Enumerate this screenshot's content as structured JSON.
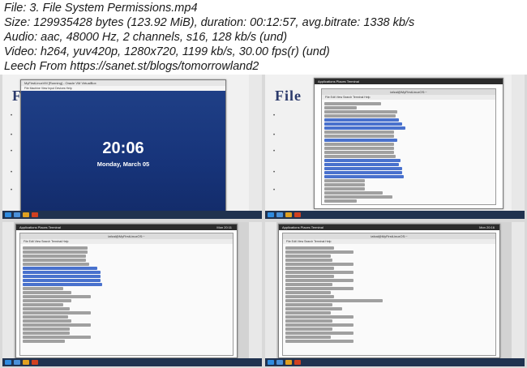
{
  "header": {
    "file": "File: 3. File System Permissions.mp4",
    "size": "Size: 129935428 bytes (123.92 MiB), duration: 00:12:57, avg.bitrate: 1338 kb/s",
    "audio": "Audio: aac, 48000 Hz, 2 channels, s16, 128 kb/s (und)",
    "video": "Video: h264, yuv420p, 1280x720, 1199 kb/s, 30.00 fps(r) (und)",
    "leech": "Leech From https://sanet.st/blogs/tomorrowland2"
  },
  "thumb1": {
    "slide_title": "File",
    "vm_title": "MyFirstLinuxVM [Running] - Oracle VM VirtualBox",
    "vm_menu": "File  Machine  View  Input  Devices  Help",
    "lock_time": "20:06",
    "lock_date": "Monday, March 05"
  },
  "thumb2": {
    "slide_title": "File",
    "term_title": "iafzal@MyFirstLinuxOS:~",
    "term_menu": "File  Edit  View  Search  Terminal  Help",
    "gnome_apps": "Applications  Places  Terminal"
  },
  "thumb3": {
    "term_title": "iafzal@MyFirstLinuxOS:~",
    "term_menu": "File  Edit  View  Search  Terminal  Help",
    "gnome_apps": "Applications  Places  Terminal",
    "gnome_time": "Mon 20:11"
  },
  "thumb4": {
    "term_title": "iafzal@MyFirstLinuxOS:~",
    "term_menu": "File  Edit  View  Search  Terminal  Help",
    "gnome_apps": "Applications  Places  Terminal",
    "gnome_time": "Mon 20:16"
  },
  "colors": {
    "lock_blue": "#1f3f86",
    "taskbar": "#20324f",
    "link_blue": "#1d4fc2"
  }
}
